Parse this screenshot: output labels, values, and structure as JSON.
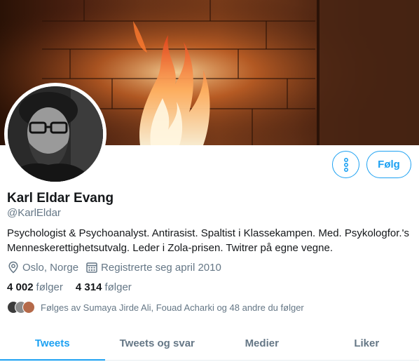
{
  "profile": {
    "name": "Karl Eldar Evang",
    "handle": "@KarlEldar",
    "bio": "Psychologist & Psychoanalyst. Antirasist. Spaltist i Klassekampen. Med. Psykologfor.'s Menneskerettighetsutvalg. Leder i Zola-prisen. Twitrer på egne vegne.",
    "location": "Oslo, Norge",
    "joined": "Registrerte seg april 2010",
    "following_count": "4 002",
    "following_label": "følger",
    "followers_count": "4 314",
    "followers_label": "følger",
    "followed_by": "Følges av Sumaya Jirde Ali, Fouad Acharki og 48 andre du følger"
  },
  "actions": {
    "more_icon": "more-vertical-icon",
    "follow_label": "Følg"
  },
  "tabs": [
    {
      "label": "Tweets",
      "active": true
    },
    {
      "label": "Tweets og svar",
      "active": false
    },
    {
      "label": "Medier",
      "active": false
    },
    {
      "label": "Liker",
      "active": false
    }
  ],
  "colors": {
    "accent": "#1da1f2",
    "secondary_text": "#657786",
    "primary_text": "#14171a"
  },
  "icons": {
    "location": "location-pin-icon",
    "calendar": "calendar-icon"
  }
}
